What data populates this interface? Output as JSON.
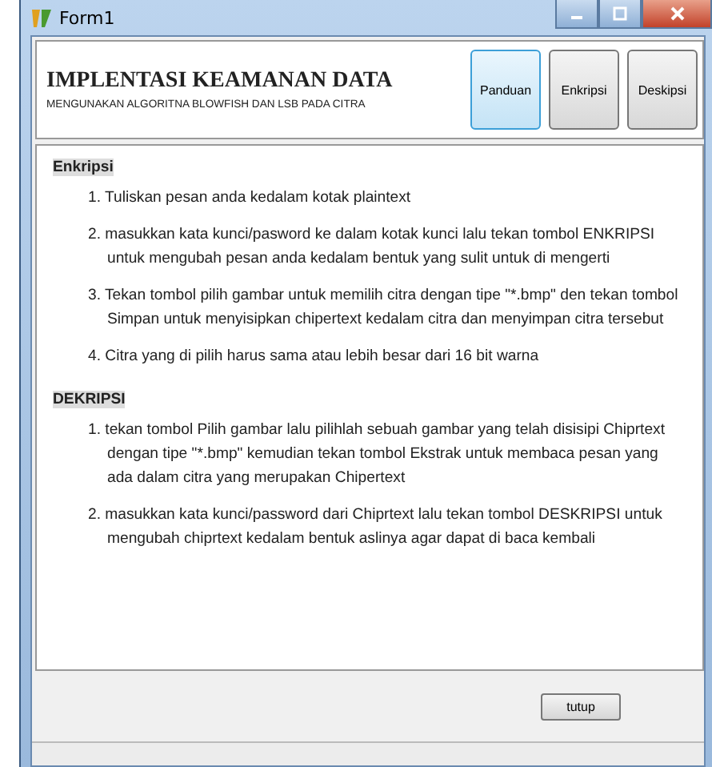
{
  "window": {
    "title": "Form1"
  },
  "header": {
    "title": "IMPLENTASI KEAMANAN DATA",
    "subtitle": "MENGUNAKAN ALGORITNA BLOWFISH DAN LSB PADA CITRA"
  },
  "nav_buttons": [
    {
      "label": "Panduan",
      "selected": true
    },
    {
      "label": "Enkripsi",
      "selected": false
    },
    {
      "label": "Deskipsi",
      "selected": false
    }
  ],
  "sections": [
    {
      "heading": "Enkripsi",
      "steps": [
        "1. Tuliskan pesan anda kedalam kotak plaintext",
        "2. masukkan kata kunci/pasword ke dalam kotak kunci lalu tekan tombol ENKRIPSI untuk mengubah pesan anda kedalam bentuk yang sulit untuk di mengerti",
        "3. Tekan tombol pilih gambar untuk memilih citra dengan tipe \"*.bmp\" den tekan tombol Simpan untuk menyisipkan chipertext kedalam citra dan  menyimpan citra tersebut",
        "4. Citra yang di pilih harus sama atau lebih besar dari 16 bit warna"
      ]
    },
    {
      "heading": "DEKRIPSI",
      "steps": [
        "1. tekan tombol Pilih gambar lalu pilihlah sebuah gambar yang telah disisipi Chiprtext dengan tipe \"*.bmp\" kemudian tekan tombol Ekstrak untuk membaca pesan yang ada dalam citra yang merupakan Chipertext",
        "2. masukkan kata kunci/password dari Chiprtext lalu tekan tombol DESKRIPSI untuk mengubah chiprtext kedalam bentuk aslinya agar dapat di baca kembali"
      ]
    }
  ],
  "close_button": "tutup"
}
